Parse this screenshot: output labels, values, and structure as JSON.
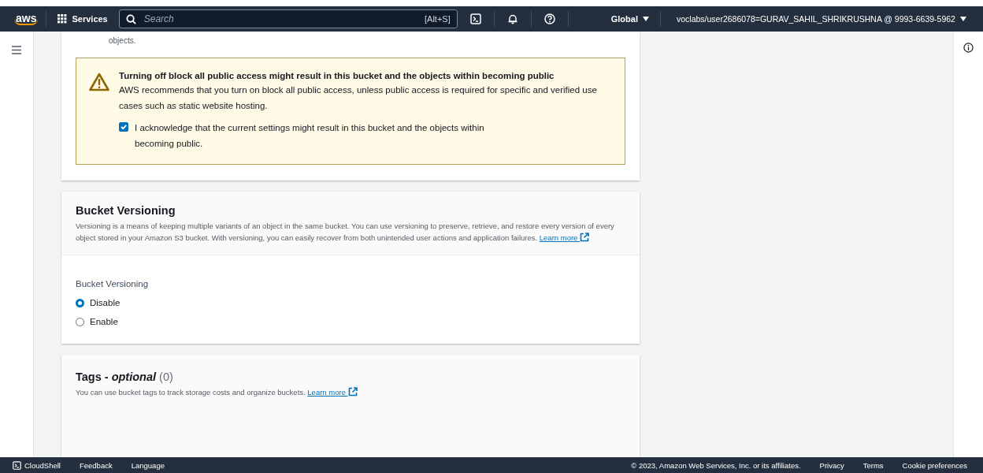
{
  "top_nav": {
    "logo": "aws",
    "services": "Services",
    "search": {
      "placeholder": "Search",
      "shortcut": "[Alt+S]"
    },
    "region": "Global",
    "account": "voclabs/user2686078=GURAV_SAHIL_SHRIKRUSHNA @ 9993-6639-5962"
  },
  "block_public_access": {
    "description_tail": "objects.",
    "warning": {
      "title": "Turning off block all public access might result in this bucket and the objects within becoming public",
      "text": "AWS recommends that you turn on block all public access, unless public access is required for specific and verified use cases such as static website hosting."
    },
    "acknowledge": {
      "label": "I acknowledge that the current settings might result in this bucket and the objects within becoming public.",
      "checked": true
    }
  },
  "bucket_versioning": {
    "title": "Bucket Versioning",
    "description": "Versioning is a means of keeping multiple variants of an object in the same bucket. You can use versioning to preserve, retrieve, and restore every version of every object stored in your Amazon S3 bucket. With versioning, you can easily recover from both unintended user actions and application failures.",
    "learn_more": "Learn more",
    "field_label": "Bucket Versioning",
    "options": [
      {
        "label": "Disable",
        "selected": true
      },
      {
        "label": "Enable",
        "selected": false
      }
    ]
  },
  "tags": {
    "title": "Tags - *optional*",
    "count": "(0)",
    "description": "You can use bucket tags to track storage costs and organize buckets.",
    "learn_more": "Learn more"
  },
  "footer": {
    "cloudshell": "CloudShell",
    "feedback": "Feedback",
    "language": "Language",
    "copyright": "© 2023, Amazon Web Services, Inc. or its affiliates.",
    "links": [
      "Privacy",
      "Terms",
      "Cookie preferences"
    ]
  }
}
